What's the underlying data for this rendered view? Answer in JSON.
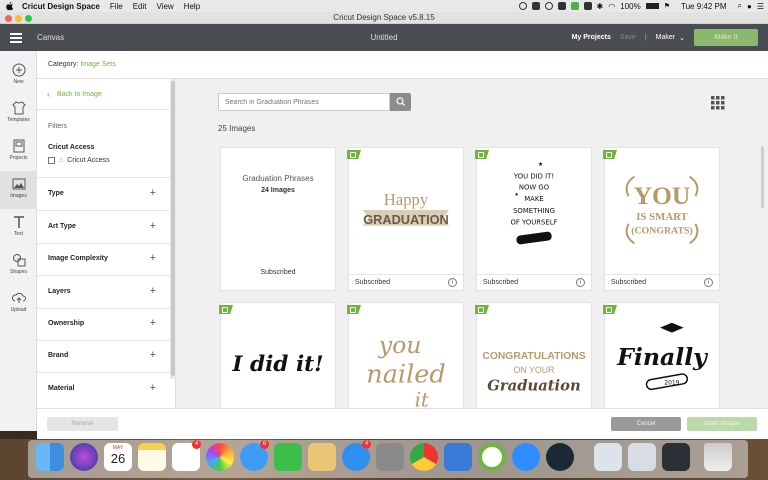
{
  "menubar": {
    "app": "Cricut Design Space",
    "items": [
      "File",
      "Edit",
      "View",
      "Help"
    ],
    "battery": "100%",
    "clock": "Tue 9:42 PM"
  },
  "window": {
    "title": "Cricut Design Space  v5.8.15"
  },
  "header": {
    "canvas": "Canvas",
    "doc_title": "Untitled",
    "my_projects": "My Projects",
    "save": "Save",
    "separator": "|",
    "machine": "Maker",
    "make_it": "Make It"
  },
  "leftbar": {
    "tools": [
      {
        "label": "New",
        "icon": "plus-circle-icon"
      },
      {
        "label": "Templates",
        "icon": "tshirt-icon"
      },
      {
        "label": "Projects",
        "icon": "projects-icon"
      },
      {
        "label": "Images",
        "icon": "image-icon"
      },
      {
        "label": "Text",
        "icon": "text-icon"
      },
      {
        "label": "Shapes",
        "icon": "shapes-icon"
      },
      {
        "label": "Upload",
        "icon": "upload-icon"
      }
    ]
  },
  "category": {
    "prefix": "Category:",
    "name": "Image Sets"
  },
  "filters": {
    "back": "Back to Image",
    "title": "Filters",
    "access_title": "Cricut Access",
    "access_option": "Cricut Access",
    "rows": [
      "Type",
      "Art Type",
      "Image Complexity",
      "Layers",
      "Ownership",
      "Brand",
      "Material"
    ]
  },
  "main": {
    "search_placeholder": "Search in Graduation Phrases",
    "count": "25 Images",
    "set_card": {
      "title": "Graduation Phrases",
      "count": "24 Images",
      "status": "Subscribed"
    },
    "cards": [
      {
        "status": "Subscribed",
        "art_lines": [
          "Happy",
          "GRADUATION"
        ]
      },
      {
        "status": "Subscribed",
        "art_lines": [
          "YOU DID IT!",
          "NOW GO",
          "MAKE",
          "SOMETHING",
          "OF YOURSELF"
        ]
      },
      {
        "status": "Subscribed",
        "art_lines": [
          "YOU",
          "IS SMART",
          "(CONGRATS)"
        ]
      },
      {
        "status": "",
        "art_lines": [
          "I did it!"
        ]
      },
      {
        "status": "",
        "art_lines": [
          "you",
          "nailed",
          "it"
        ]
      },
      {
        "status": "",
        "art_lines": [
          "CONGRATULATIONS",
          "ON YOUR",
          "Graduation"
        ]
      },
      {
        "status": "",
        "art_lines": [
          "Finally",
          "2019"
        ]
      }
    ]
  },
  "bottom": {
    "remove": "Remove",
    "cancel": "Cancel",
    "insert": "Insert Images"
  },
  "dock": {
    "calendar_month": "MAY",
    "calendar_day": "26",
    "badges": [
      "4",
      "6",
      "4"
    ]
  },
  "colors": {
    "accent": "#6fb43f",
    "header": "#4a4d52",
    "gold": "#b89a6a"
  }
}
